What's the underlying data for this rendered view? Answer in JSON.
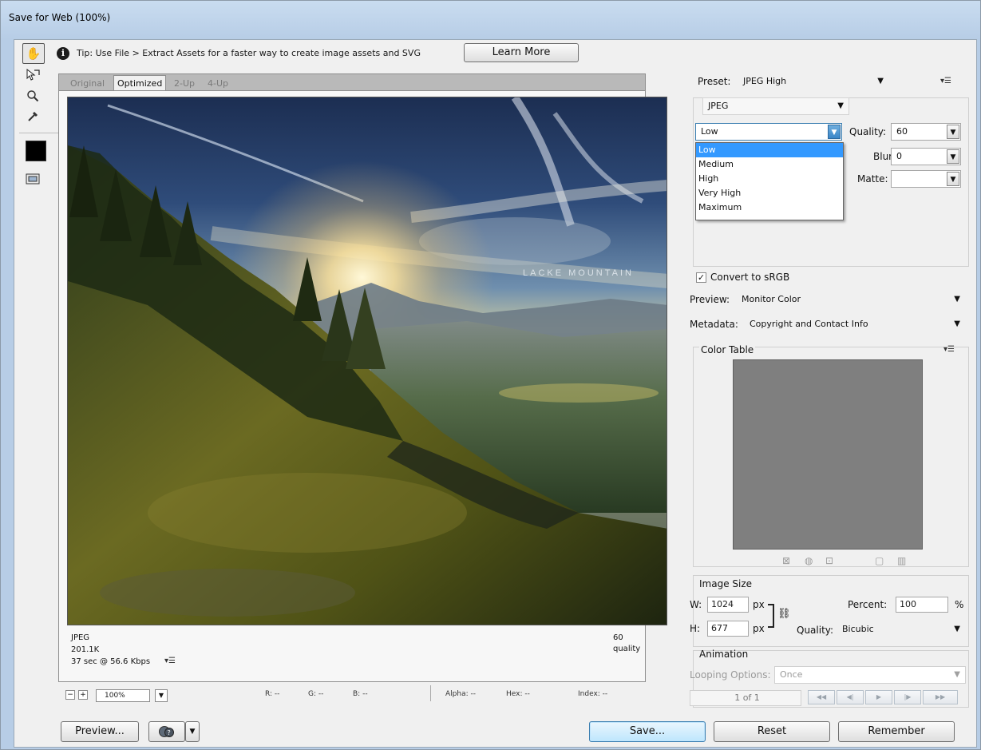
{
  "window": {
    "title": "Save for Web (100%)"
  },
  "tip": {
    "text": "Tip: Use File > Extract Assets for a faster way to create image assets and SVG",
    "learn_more": "Learn More"
  },
  "tools": [
    {
      "name": "hand-tool",
      "glyph": "✋"
    },
    {
      "name": "slice-select-tool",
      "glyph": "⇱"
    },
    {
      "name": "zoom-tool",
      "glyph": "🔍"
    },
    {
      "name": "eyedropper-tool",
      "glyph": "⁄"
    }
  ],
  "view_tabs": [
    "Original",
    "Optimized",
    "2-Up",
    "4-Up"
  ],
  "image": {
    "watermark": "LACKE MOUNTAIN",
    "format": "JPEG",
    "size": "201.1K",
    "time": "37 sec @ 56.6 Kbps",
    "quality_label": "60 quality"
  },
  "zoom": {
    "value": "100%"
  },
  "readouts": {
    "r": "R: --",
    "g": "G: --",
    "b": "B: --",
    "alpha": "Alpha: --",
    "hex": "Hex: --",
    "index": "Index: --"
  },
  "preset": {
    "label": "Preset:",
    "value": "JPEG High"
  },
  "format_select": {
    "value": "JPEG"
  },
  "quality_level": {
    "value": "Low",
    "options": [
      "Low",
      "Medium",
      "High",
      "Very High",
      "Maximum"
    ],
    "highlighted": "Low"
  },
  "quality": {
    "label": "Quality:",
    "value": "60"
  },
  "blur": {
    "label": "Blur:",
    "value": "0"
  },
  "matte": {
    "label": "Matte:",
    "value": ""
  },
  "convert_srgb": {
    "label": "Convert to sRGB",
    "checked": true
  },
  "preview_setting": {
    "label": "Preview:",
    "value": "Monitor Color"
  },
  "metadata": {
    "label": "Metadata:",
    "value": "Copyright and Contact Info"
  },
  "color_table": {
    "label": "Color Table"
  },
  "image_size": {
    "label": "Image Size",
    "w_label": "W:",
    "w": "1024",
    "h_label": "H:",
    "h": "677",
    "unit": "px",
    "percent_label": "Percent:",
    "percent": "100",
    "percent_unit": "%",
    "quality_label": "Quality:",
    "quality": "Bicubic"
  },
  "animation": {
    "label": "Animation",
    "looping_label": "Looping Options:",
    "looping": "Once",
    "frame": "1 of 1"
  },
  "buttons": {
    "preview": "Preview...",
    "save": "Save...",
    "reset": "Reset",
    "remember": "Remember"
  }
}
